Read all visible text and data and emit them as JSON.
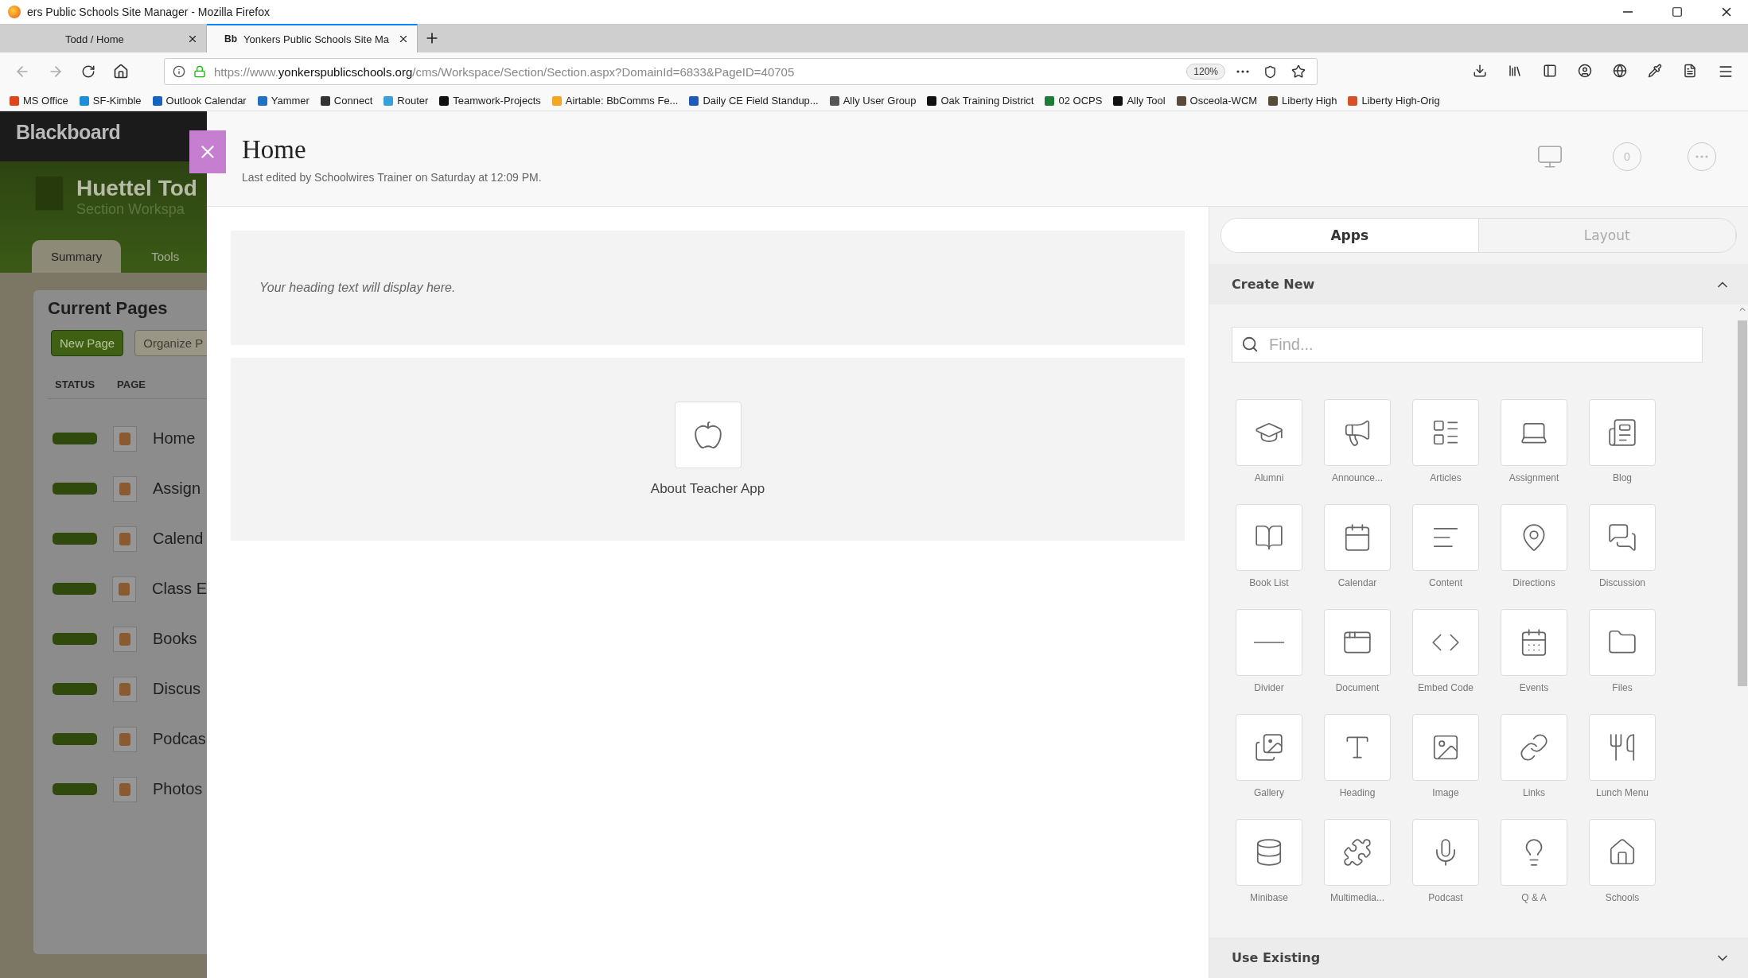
{
  "window": {
    "title": "ers Public Schools Site Manager - Mozilla Firefox"
  },
  "browser_tabs": [
    {
      "label": "Todd / Home",
      "selected": false
    },
    {
      "favicon": "Bb",
      "label": "Yonkers Public Schools Site Ma",
      "selected": true
    }
  ],
  "address_bar": {
    "url_prefix": "https://www.",
    "url_domain": "yonkerspublicschools.org",
    "url_path": "/cms/Workspace/Section/Section.aspx?DomainId=6833&PageID=40705",
    "zoom": "120%"
  },
  "bookmarks": [
    {
      "label": "MS Office",
      "color": "#e0461b"
    },
    {
      "label": "SF-Kimble",
      "color": "#1a8fd8"
    },
    {
      "label": "Outlook Calendar",
      "color": "#1565c0"
    },
    {
      "label": "Yammer",
      "color": "#2270c4"
    },
    {
      "label": "Connect",
      "color": "#333333"
    },
    {
      "label": "Router",
      "color": "#3aa0d8"
    },
    {
      "label": "Teamwork-Projects",
      "color": "#111111"
    },
    {
      "label": "Airtable: BbComms Fe...",
      "color": "#f5a623"
    },
    {
      "label": "Daily CE Field Standup...",
      "color": "#1e5bb8"
    },
    {
      "label": "Ally User Group",
      "color": "#555555"
    },
    {
      "label": "Oak Training District",
      "color": "#111111"
    },
    {
      "label": "02 OCPS",
      "color": "#1e7b3a"
    },
    {
      "label": "Ally Tool",
      "color": "#111111"
    },
    {
      "label": "Osceola-WCM",
      "color": "#5a4a3a"
    },
    {
      "label": "Liberty High",
      "color": "#5a4a3a"
    },
    {
      "label": "Liberty High-Orig",
      "color": "#d8502a"
    }
  ],
  "sidebar": {
    "brand": "Blackboard",
    "title": "Huettel Tod",
    "subtitle": "Section Workspa",
    "tabs": [
      {
        "label": "Summary",
        "selected": true
      },
      {
        "label": "Tools",
        "selected": false
      }
    ],
    "heading": "Current Pages",
    "buttons": [
      "New Page",
      "Organize P"
    ],
    "columns": [
      "STATUS",
      "PAGE"
    ],
    "pages": [
      "Home",
      "Assign",
      "Calend",
      "Class E",
      "Books",
      "Discus",
      "Podcas",
      "Photos"
    ]
  },
  "editor": {
    "title": "Home",
    "meta": "Last edited by Schoolwires Trainer on Saturday at 12:09 PM.",
    "notification_count": "0",
    "heading_placeholder": "Your heading text will display here.",
    "app_label": "About Teacher App"
  },
  "panel": {
    "tabs": [
      {
        "label": "Apps",
        "selected": true
      },
      {
        "label": "Layout",
        "selected": false
      }
    ],
    "sections": [
      {
        "title": "Create New",
        "expanded": true
      },
      {
        "title": "Use Existing",
        "expanded": false
      }
    ],
    "search": {
      "placeholder": "Find..."
    },
    "apps": [
      "Alumni",
      "Announce...",
      "Articles",
      "Assignment",
      "Blog",
      "Book List",
      "Calendar",
      "Content",
      "Directions",
      "Discussion",
      "Divider",
      "Document",
      "Embed Code",
      "Events",
      "Files",
      "Gallery",
      "Heading",
      "Image",
      "Links",
      "Lunch Menu",
      "Minibase",
      "Multimedia...",
      "Podcast",
      "Q & A",
      "Schools"
    ]
  }
}
